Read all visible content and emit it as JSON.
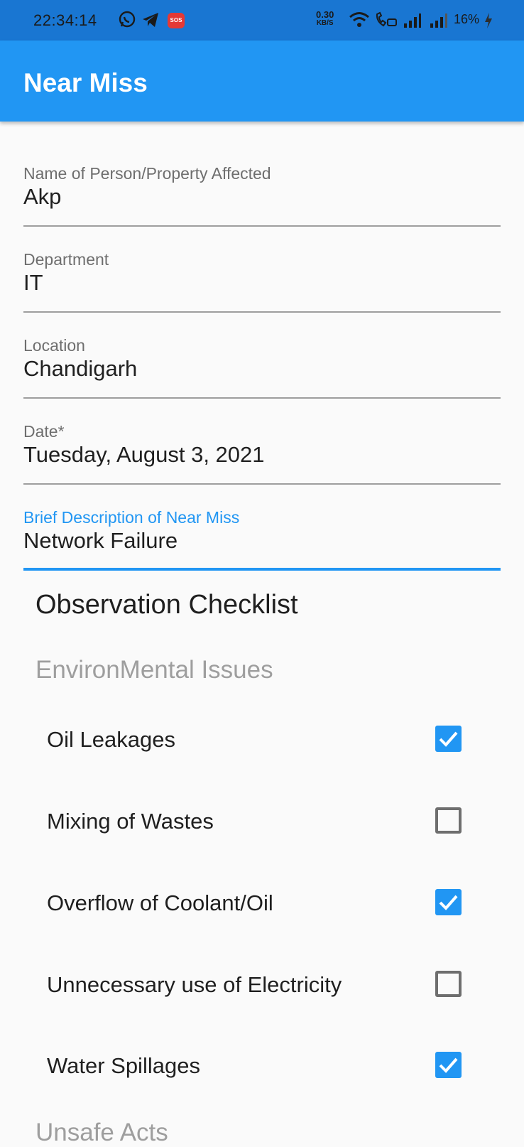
{
  "status_bar": {
    "time": "22:34:14",
    "network_speed_value": "0.30",
    "network_speed_unit": "KB/S",
    "battery": "16%",
    "sos_label": "SOS"
  },
  "app_bar": {
    "title": "Near Miss"
  },
  "form": {
    "fields": [
      {
        "label": "Name of Person/Property Affected",
        "value": "Akp"
      },
      {
        "label": "Department",
        "value": "IT"
      },
      {
        "label": "Location",
        "value": "Chandigarh"
      },
      {
        "label": "Date*",
        "value": "Tuesday, August 3, 2021"
      },
      {
        "label": "Brief Description of Near Miss",
        "value": "Network Failure"
      }
    ]
  },
  "checklist": {
    "title": "Observation Checklist",
    "groups": [
      {
        "title": "EnvironMental Issues",
        "items": [
          {
            "label": "Oil Leakages",
            "checked": true
          },
          {
            "label": "Mixing of Wastes",
            "checked": false
          },
          {
            "label": "Overflow of Coolant/Oil",
            "checked": true
          },
          {
            "label": "Unnecessary use of Electricity",
            "checked": false
          },
          {
            "label": "Water Spillages",
            "checked": true
          }
        ]
      },
      {
        "title": "Unsafe Acts"
      }
    ]
  },
  "colors": {
    "primary": "#2196f3",
    "status_bar": "#1976d2"
  }
}
